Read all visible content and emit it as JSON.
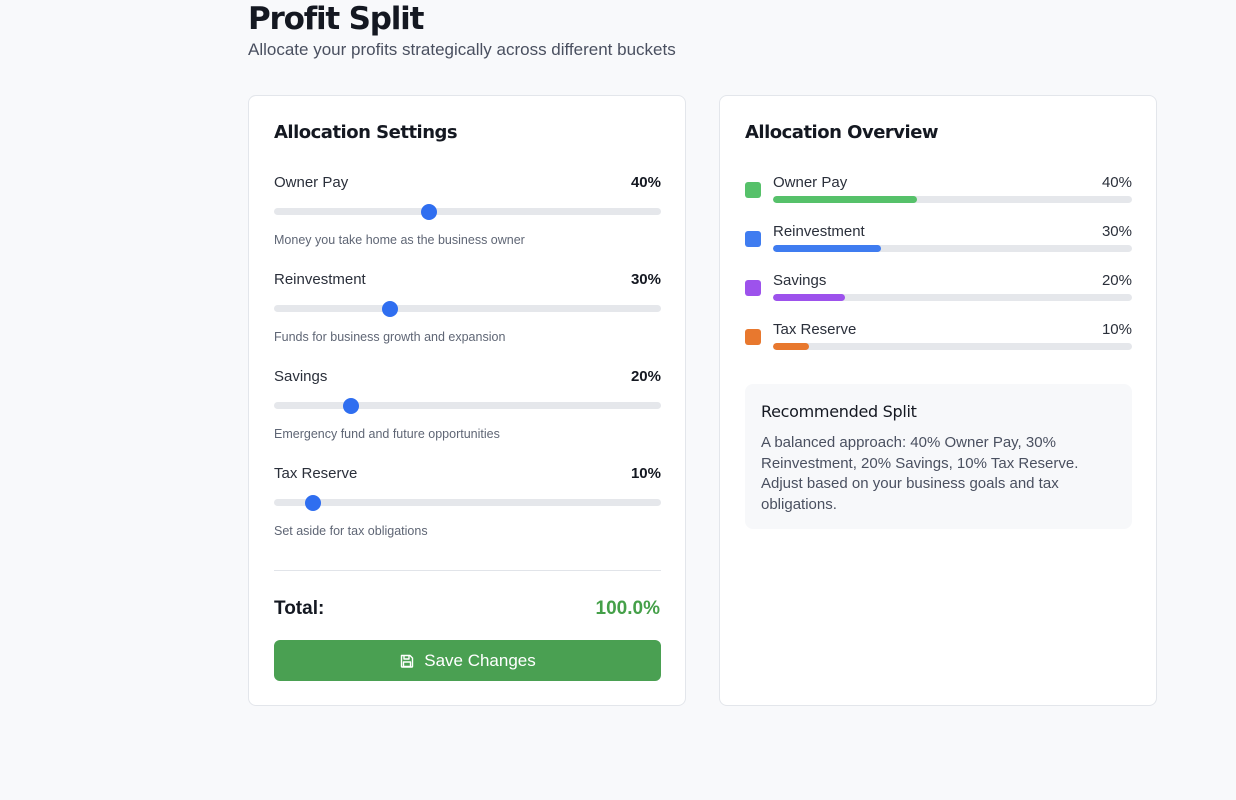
{
  "header": {
    "title": "Profit Split",
    "subtitle": "Allocate your profits strategically across different buckets"
  },
  "settings": {
    "title": "Allocation Settings",
    "sliders": [
      {
        "label": "Owner Pay",
        "value_text": "40%",
        "value": 40,
        "description": "Money you take home as the business owner"
      },
      {
        "label": "Reinvestment",
        "value_text": "30%",
        "value": 30,
        "description": "Funds for business growth and expansion"
      },
      {
        "label": "Savings",
        "value_text": "20%",
        "value": 20,
        "description": "Emergency fund and future opportunities"
      },
      {
        "label": "Tax Reserve",
        "value_text": "10%",
        "value": 10,
        "description": "Set aside for tax obligations"
      }
    ],
    "total_label": "Total:",
    "total_value": "100.0%",
    "save_label": "Save Changes",
    "save_icon": "save-icon"
  },
  "overview": {
    "title": "Allocation Overview",
    "items": [
      {
        "label": "Owner Pay",
        "value_text": "40%",
        "value": 40,
        "color": "#56c16a"
      },
      {
        "label": "Reinvestment",
        "value_text": "30%",
        "value": 30,
        "color": "#3f7cf0"
      },
      {
        "label": "Savings",
        "value_text": "20%",
        "value": 20,
        "color": "#9d52ec"
      },
      {
        "label": "Tax Reserve",
        "value_text": "10%",
        "value": 10,
        "color": "#e8782e"
      }
    ],
    "recommended": {
      "title": "Recommended Split",
      "text": "A balanced approach: 40% Owner Pay, 30% Reinvestment, 20% Savings, 10% Tax Reserve. Adjust based on your business goals and tax obligations."
    }
  },
  "colors": {
    "accent": "#2f6ef0",
    "save_button": "#4aa052",
    "total_value": "#45a049"
  }
}
